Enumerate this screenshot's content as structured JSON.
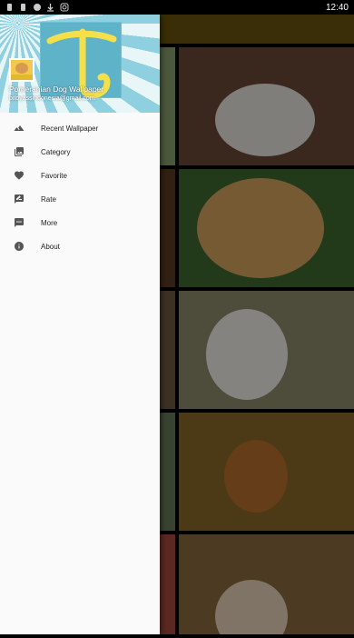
{
  "status_bar": {
    "time": "12:40",
    "icons": [
      "notification-icon",
      "notification-icon",
      "vpn-icon",
      "download-icon",
      "instagram-icon"
    ]
  },
  "drawer": {
    "header": {
      "app_name": "Pomeranian Dog Wallpaper",
      "email": "bitoyassindonesia@gmail.com"
    },
    "menu": [
      {
        "label": "Recent Wallpaper",
        "icon": "landscape-icon"
      },
      {
        "label": "Category",
        "icon": "photo-library-icon"
      },
      {
        "label": "Favorite",
        "icon": "heart-icon"
      },
      {
        "label": "Rate",
        "icon": "rate-review-icon"
      },
      {
        "label": "More",
        "icon": "more-dots-icon"
      },
      {
        "label": "About",
        "icon": "info-icon"
      }
    ]
  },
  "colors": {
    "app_bar": "#6b5410",
    "drawer_bg": "#fafafa",
    "header_art": "#5fb3c9"
  },
  "grid": {
    "tiles": [
      {
        "subject": "fluffy orange pomeranian"
      },
      {
        "subject": "white pomeranians"
      },
      {
        "subject": "orange pomeranian face"
      },
      {
        "subject": "cream pomeranian smiling"
      },
      {
        "subject": "three pomeranian puppies"
      },
      {
        "subject": "white pomeranian"
      },
      {
        "subject": "cream pomeranian close-up"
      },
      {
        "subject": "pomeranian on autumn leaves"
      },
      {
        "subject": "pomeranian near flowers"
      },
      {
        "subject": "pomeranian in grass"
      }
    ]
  }
}
